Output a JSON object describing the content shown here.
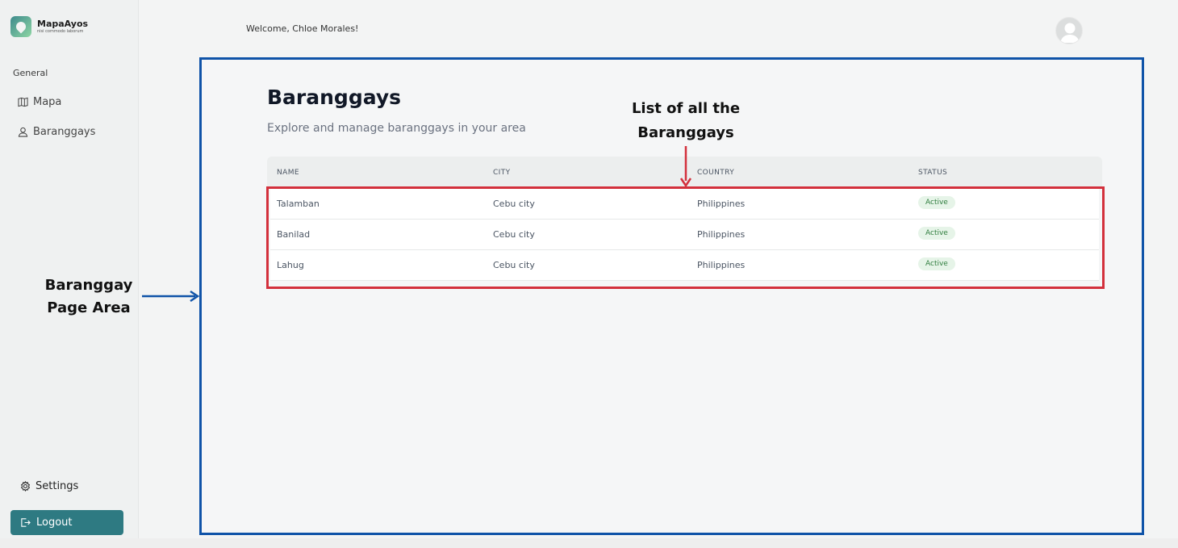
{
  "app": {
    "name": "MapaAyos",
    "tagline": "nisi commodo laborum"
  },
  "sidebar": {
    "section_label": "General",
    "items": [
      {
        "label": "Mapa",
        "icon": "map-icon"
      },
      {
        "label": "Baranggays",
        "icon": "user-icon"
      }
    ],
    "settings_label": "Settings",
    "logout_label": "Logout"
  },
  "header": {
    "welcome": "Welcome, Chloe Morales!"
  },
  "main": {
    "title": "Baranggays",
    "subtitle": "Explore and manage baranggays in your area",
    "table": {
      "columns": [
        "NAME",
        "CITY",
        "COUNTRY",
        "STATUS"
      ],
      "rows": [
        {
          "name": "Talamban",
          "city": "Cebu city",
          "country": "Philippines",
          "status": "Active"
        },
        {
          "name": "Banilad",
          "city": "Cebu city",
          "country": "Philippines",
          "status": "Active"
        },
        {
          "name": "Lahug",
          "city": "Cebu city",
          "country": "Philippines",
          "status": "Active"
        }
      ]
    }
  },
  "annotations": {
    "list_label_line1": "List of all the",
    "list_label_line2": "Baranggays",
    "page_label_line1": "Baranggay",
    "page_label_line2": "Page Area"
  },
  "colors": {
    "accent": "#2e7a82",
    "page_area_border": "#0f53a8",
    "list_border": "#d3303c",
    "status_active": "#2f7d3e"
  }
}
